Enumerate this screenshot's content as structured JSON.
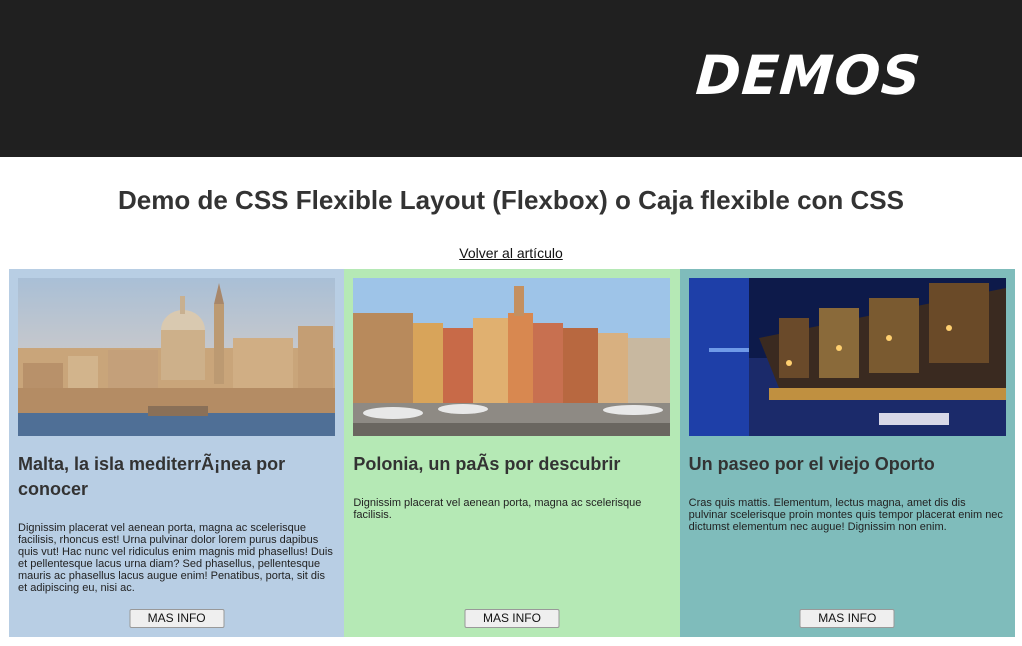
{
  "header": {
    "logo_text": "DEMOS"
  },
  "page": {
    "title": "Demo de CSS Flexible Layout (Flexbox) o Caja flexible con CSS",
    "back_link": "Volver al artículo"
  },
  "colors": {
    "header_bg": "#202020",
    "card1_bg": "#b8cee4",
    "card2_bg": "#b5e9b5",
    "card3_bg": "#7fbcbb"
  },
  "cards": [
    {
      "title": "Malta, la isla mediterrÃ¡nea por conocer",
      "text": "Dignissim placerat vel aenean porta, magna ac scelerisque facilisis, rhoncus est! Urna pulvinar dolor lorem purus dapibus quis vut! Hac nunc vel ridiculus enim magnis mid phasellus! Duis et pellentesque lacus urna diam? Sed phasellus, pellentesque mauris ac phasellus lacus augue enim! Penatibus, porta, sit dis et adipiscing eu, nisi ac.",
      "button": "MAS INFO",
      "image": "malta-cityscape-photo"
    },
    {
      "title": "Polonia, un paÃs por descubrir",
      "text": "Dignissim placerat vel aenean porta, magna ac scelerisque facilisis.",
      "button": "MAS INFO",
      "image": "warsaw-old-town-square-photo"
    },
    {
      "title": "Un paseo por el viejo Oporto",
      "text": "Cras quis mattis. Elementum, lectus magna, amet dis dis pulvinar scelerisque proin montes quis tempor placerat enim nec dictumst elementum nec augue! Dignissim non enim.",
      "button": "MAS INFO",
      "image": "porto-night-riverside-photo"
    }
  ]
}
